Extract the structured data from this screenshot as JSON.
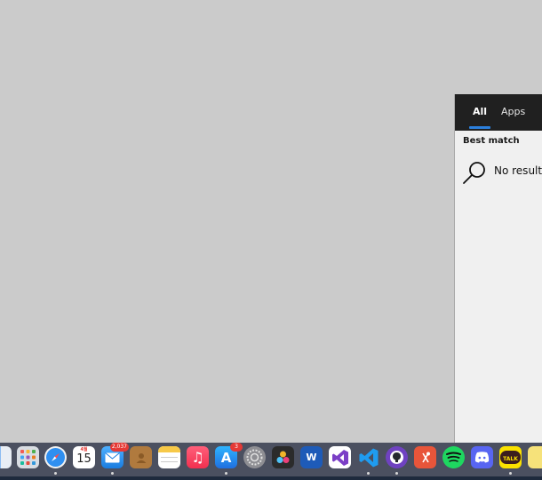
{
  "search_panel": {
    "tabs": [
      {
        "label": "All",
        "active": true
      },
      {
        "label": "Apps",
        "active": false
      }
    ],
    "section_heading": "Best match",
    "result_text": "No results",
    "accent_color": "#2b7fdc"
  },
  "dock": {
    "calendar": {
      "month": "4월",
      "day": "15"
    },
    "mail_badge": "2,037",
    "appstore_badge": "3",
    "word_letter": "W",
    "kakaotalk_label": "TALK"
  }
}
